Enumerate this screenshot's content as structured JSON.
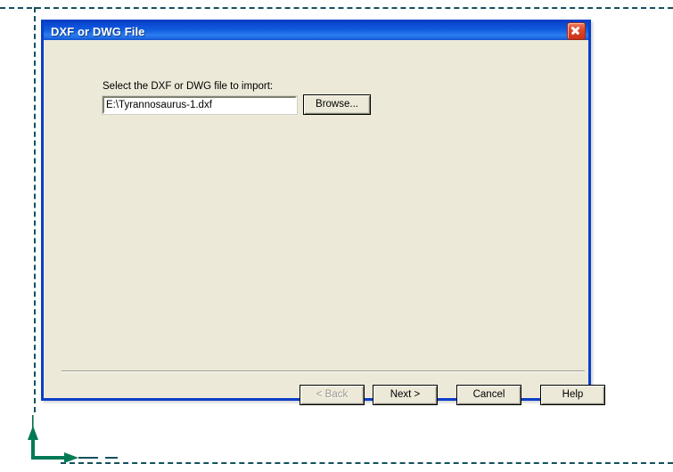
{
  "canvas": {
    "ucs_icon_name": "ucs-origin-axis-icon",
    "axis_color": "#007a55",
    "limits_border_color": "#14505e"
  },
  "dialog": {
    "title": "DXF or DWG File",
    "close_button_label": "Close",
    "titlebar_gradient_start": "#0a46c8",
    "titlebar_gradient_end": "#2c7df0",
    "body_color": "#ece9d8",
    "border_color": "#0a3fc8",
    "field": {
      "label": "Select the DXF or DWG file to import:",
      "value": "E:\\Tyrannosaurus-1.dxf",
      "placeholder": ""
    },
    "browse_button": {
      "label": "Browse...",
      "enabled": true
    },
    "footer_buttons": [
      {
        "name": "back",
        "label": "< Back",
        "enabled": false
      },
      {
        "name": "next",
        "label": "Next >",
        "enabled": true
      },
      {
        "name": "cancel",
        "label": "Cancel",
        "enabled": true
      },
      {
        "name": "help",
        "label": "Help",
        "enabled": true
      }
    ]
  }
}
